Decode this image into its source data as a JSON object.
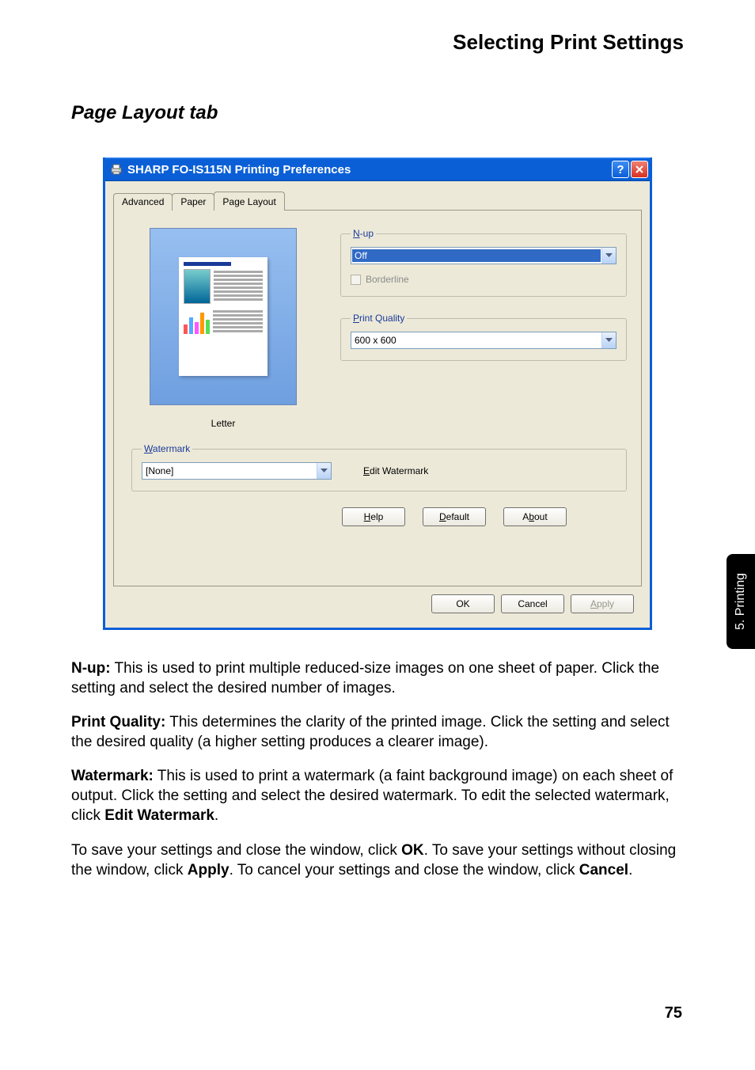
{
  "header": {
    "title": "Selecting Print Settings"
  },
  "section": {
    "title": "Page Layout tab"
  },
  "dialog": {
    "title": "SHARP FO-IS115N Printing Preferences",
    "tabs": {
      "advanced": "Advanced",
      "paper": "Paper",
      "page_layout": "Page Layout"
    },
    "preview_label": "Letter",
    "nup": {
      "legend_pre": "N",
      "legend_post": "-up",
      "value": "Off",
      "borderline_pre": "Border",
      "borderline_ul": "l",
      "borderline_post": "ine"
    },
    "quality": {
      "legend_ul": "P",
      "legend_post": "rint Quality",
      "value": "600 x 600"
    },
    "watermark": {
      "legend_ul": "W",
      "legend_post": "atermark",
      "value": "[None]",
      "edit_ul": "E",
      "edit_post": "dit Watermark"
    },
    "buttons": {
      "help_ul": "H",
      "help_post": "elp",
      "default_ul": "D",
      "default_post": "efault",
      "about_pre": "A",
      "about_ul": "b",
      "about_post": "out",
      "ok": "OK",
      "cancel": "Cancel",
      "apply_ul": "A",
      "apply_post": "pply"
    }
  },
  "copy": {
    "p1_label": "N-up:",
    "p1_text": " This is used to print multiple reduced-size images on one sheet of paper. Click the setting and select the desired number of images.",
    "p2_label": "Print Quality:",
    "p2_text": " This determines the clarity of the printed image. Click the setting and select the desired quality (a higher setting produces a clearer image).",
    "p3_label": "Watermark:",
    "p3_text_a": " This is used to print a watermark (a faint background image) on each sheet of output. Click the setting and select the desired watermark. To edit the selected watermark, click ",
    "p3_bold": "Edit Watermark",
    "p3_text_b": ".",
    "p4_a": "To save your settings and close the window, click ",
    "p4_ok": "OK",
    "p4_b": ". To save your settings without closing the window, click ",
    "p4_apply": "Apply",
    "p4_c": ". To cancel your settings and close the window, click ",
    "p4_cancel": "Cancel",
    "p4_d": "."
  },
  "side_tab": "5. Printing",
  "page_number": "75"
}
